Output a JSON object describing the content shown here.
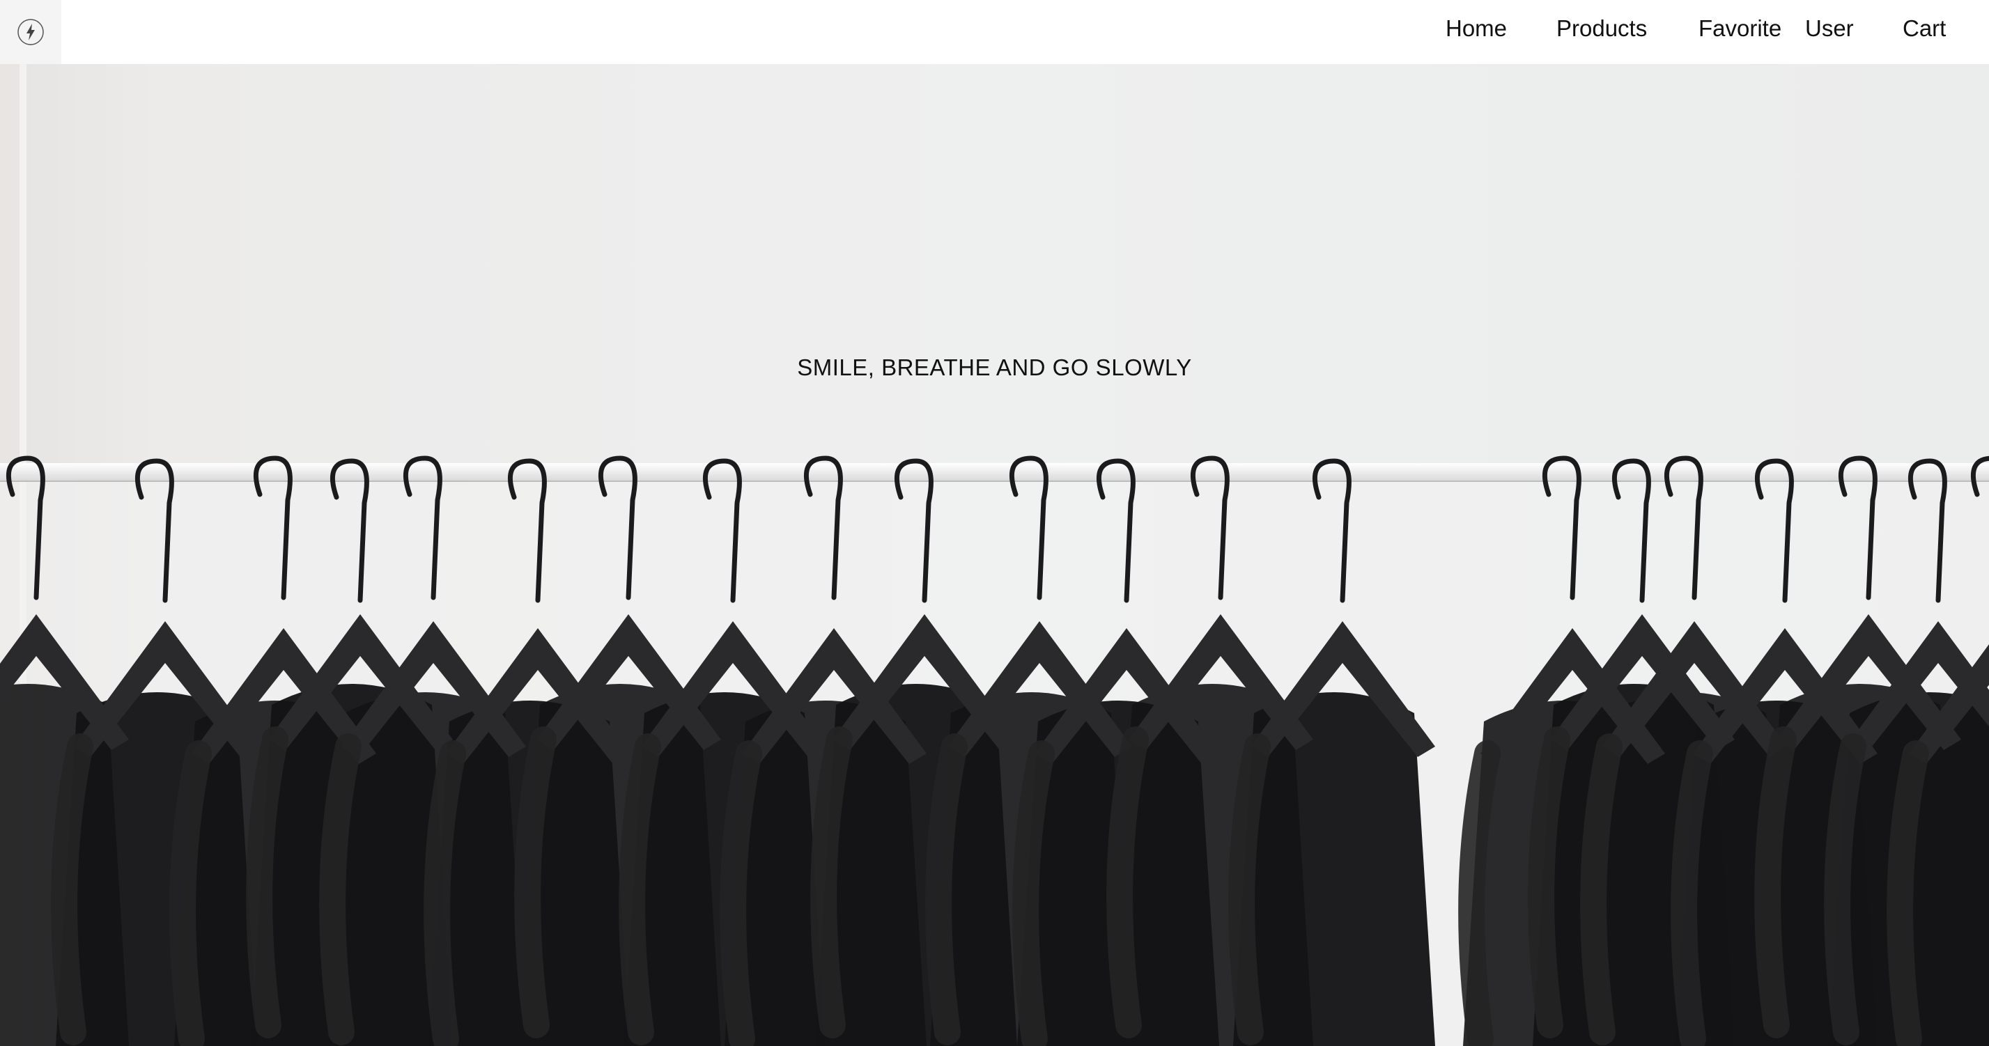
{
  "nav": {
    "home": "Home",
    "products": "Products",
    "favorite": "Favorite",
    "user": "User",
    "cart": "Cart"
  },
  "hero": {
    "tagline": "SMILE, BREATHE AND GO SLOWLY"
  },
  "colors": {
    "header_bg": "#ffffff",
    "logo_bg": "#f4f4f4",
    "wall": "#ececec",
    "garments": "#141416",
    "hangers": "#2a2a2c",
    "text": "#111111"
  },
  "icons": {
    "logo": "lightning-circle-logo-icon"
  }
}
